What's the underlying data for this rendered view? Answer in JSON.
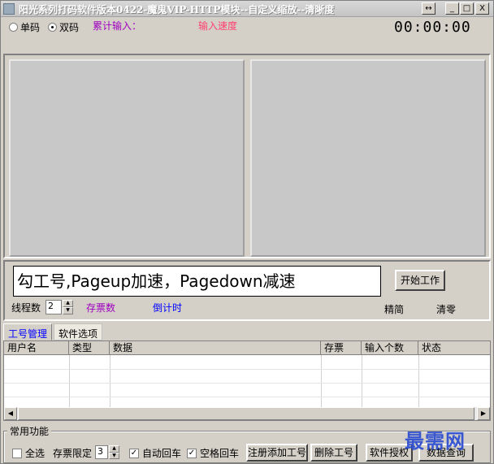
{
  "window": {
    "title": "阳光系列打码软件版本0422-魔鬼VIP-HTTP模块--自定义缩放--清晰度",
    "buttons": {
      "resize": "↔",
      "minimize": "_",
      "maximize": "□",
      "close": "X"
    }
  },
  "mode": {
    "single_label": "单码",
    "double_label": "双码",
    "selected": "双码"
  },
  "stats": {
    "cumulative_label": "累计输入：",
    "speed_label": "输入速度",
    "timer": "00:00:00"
  },
  "work": {
    "hint_text": "勾工号,Pageup加速，Pagedown减速",
    "start_button": "开始工作",
    "threads_label": "线程数",
    "threads_value": "2",
    "tickets_label": "存票数",
    "countdown_label": "倒计时",
    "simplified_label": "精简",
    "clear_label": "清零"
  },
  "tabs": [
    {
      "label": "工号管理",
      "active": true
    },
    {
      "label": "软件选项",
      "active": false
    }
  ],
  "table": {
    "columns": [
      "用户名",
      "类型",
      "数据",
      "存票",
      "输入个数",
      "状态"
    ],
    "rows": []
  },
  "common": {
    "title": "常用功能",
    "select_all": {
      "label": "全选",
      "checked": false
    },
    "ticket_limit_label": "存票限定",
    "ticket_limit_value": "3",
    "auto_enter": {
      "label": "自动回车",
      "checked": true
    },
    "space_enter": {
      "label": "空格回车",
      "checked": true
    },
    "btn_register": "注册添加工号",
    "btn_delete": "删除工号",
    "btn_license": "软件授权",
    "btn_query": "数据查询"
  },
  "watermark": "最需网",
  "colors": {
    "purple": "#a000c0",
    "pink": "#ff4070",
    "blue": "#0000ff",
    "window_bg": "#d4d0c8"
  }
}
